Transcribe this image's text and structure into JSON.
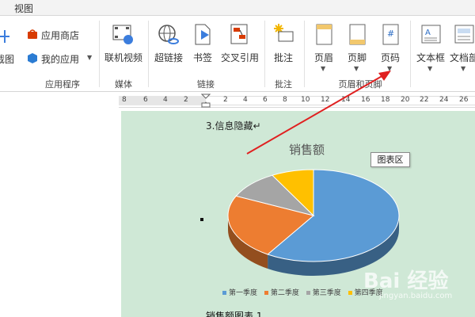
{
  "tabbar": {
    "view_tab": "视图"
  },
  "ribbon": {
    "groups": {
      "apps": {
        "label": "应用程序",
        "store": "应用商店",
        "my_apps": "我的应用",
        "screenshot_partial": "截图"
      },
      "media": {
        "label": "媒体",
        "online_video": "联机视频"
      },
      "links": {
        "label": "链接",
        "hyperlink": "超链接",
        "bookmark": "书签",
        "cross_ref": "交叉引用"
      },
      "comments": {
        "label": "批注",
        "comment": "批注"
      },
      "header_footer": {
        "label": "页眉和页脚",
        "header": "页眉",
        "footer": "页脚",
        "page_number": "页码"
      },
      "text": {
        "textbox": "文本框",
        "doc_parts_partial": "文档部"
      }
    }
  },
  "ruler": {
    "ticks": [
      "8",
      "6",
      "4",
      "2",
      "2",
      "4",
      "6",
      "8",
      "10",
      "12",
      "14",
      "16",
      "18",
      "20",
      "22",
      "24",
      "26"
    ]
  },
  "document": {
    "heading": "3.信息隐藏↵",
    "caption": "销售额图表 1"
  },
  "chart_data": {
    "type": "pie",
    "title": "销售额",
    "categories": [
      "第一季度",
      "第二季度",
      "第三季度",
      "第四季度"
    ],
    "values": [
      59,
      23,
      10,
      8
    ],
    "colors": [
      "#5b9bd5",
      "#ed7d31",
      "#a5a5a5",
      "#ffc000"
    ],
    "legend_placement": "bottom",
    "style": "3d"
  },
  "tooltip": {
    "text": "图表区"
  },
  "watermark": {
    "text": "Bai 经验",
    "sub": "jingyan.baidu.com"
  }
}
